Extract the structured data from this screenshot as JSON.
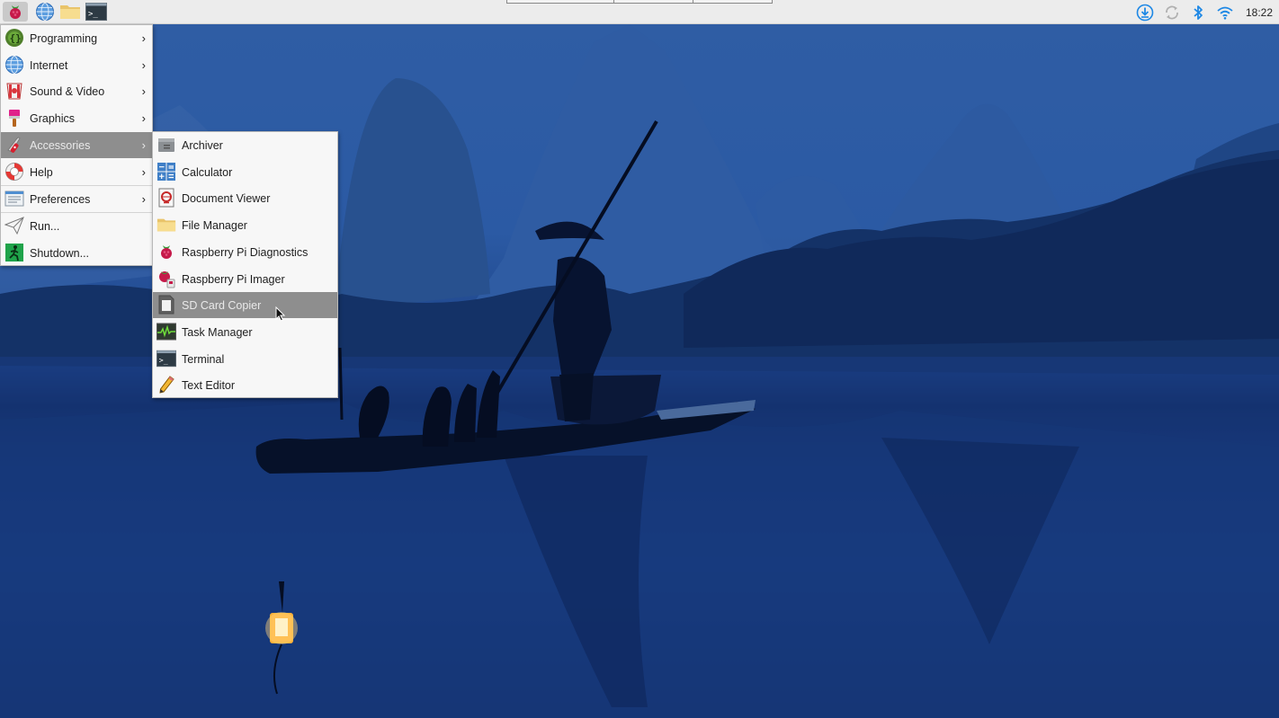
{
  "panel": {
    "launchers": [
      {
        "name": "raspberry-menu",
        "icon": "raspberry-icon"
      },
      {
        "name": "web-browser",
        "icon": "globe-icon"
      },
      {
        "name": "file-manager",
        "icon": "folder-icon"
      },
      {
        "name": "terminal",
        "icon": "terminal-icon"
      }
    ],
    "tray_icons": [
      "download-update-icon",
      "network-sync-icon",
      "bluetooth-icon",
      "wifi-icon"
    ],
    "clock": "18:22"
  },
  "main_menu": {
    "items": [
      {
        "label": "Programming",
        "icon": "programming-icon",
        "submenu": true
      },
      {
        "label": "Internet",
        "icon": "globe-icon",
        "submenu": true
      },
      {
        "label": "Sound & Video",
        "icon": "sound-video-icon",
        "submenu": true
      },
      {
        "label": "Graphics",
        "icon": "paintbrush-icon",
        "submenu": true
      },
      {
        "label": "Accessories",
        "icon": "swiss-knife-icon",
        "submenu": true,
        "highlighted": true
      },
      {
        "label": "Help",
        "icon": "lifebuoy-icon",
        "submenu": true
      },
      {
        "label": "Preferences",
        "icon": "preferences-icon",
        "submenu": true
      },
      {
        "label": "Run...",
        "icon": "paper-plane-icon",
        "submenu": false
      },
      {
        "label": "Shutdown...",
        "icon": "exit-icon",
        "submenu": false
      }
    ]
  },
  "accessories_menu": {
    "items": [
      {
        "label": "Archiver",
        "icon": "archive-box-icon"
      },
      {
        "label": "Calculator",
        "icon": "calculator-icon"
      },
      {
        "label": "Document Viewer",
        "icon": "document-viewer-icon"
      },
      {
        "label": "File Manager",
        "icon": "folder-icon"
      },
      {
        "label": "Raspberry Pi Diagnostics",
        "icon": "raspberry-icon"
      },
      {
        "label": "Raspberry Pi Imager",
        "icon": "imager-icon"
      },
      {
        "label": "SD Card Copier",
        "icon": "sd-card-icon",
        "highlighted": true
      },
      {
        "label": "Task Manager",
        "icon": "task-manager-icon"
      },
      {
        "label": "Terminal",
        "icon": "terminal-icon"
      },
      {
        "label": "Text Editor",
        "icon": "pencil-icon"
      }
    ]
  },
  "colors": {
    "menu_highlight": "#8e8e8e",
    "panel_bg": "#ececec",
    "accent_blue": "#1e88e5"
  }
}
